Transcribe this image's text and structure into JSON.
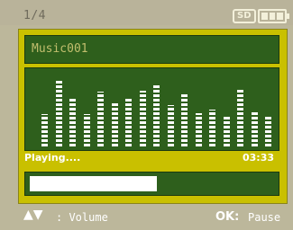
{
  "status_bar": {
    "page_indicator": "1/4",
    "storage_badge": "SD",
    "battery": {
      "icon": "battery-icon",
      "level": 1.0
    }
  },
  "player": {
    "track_title": "Music001",
    "status": "Playing....",
    "time": "03:33",
    "progress": 0.52,
    "visualizer_levels": [
      0.46,
      0.95,
      0.69,
      0.46,
      0.77,
      0.62,
      0.7,
      0.78,
      0.86,
      0.58,
      0.74,
      0.47,
      0.52,
      0.44,
      0.8,
      0.5,
      0.43
    ]
  },
  "footer": {
    "nav_arrows": "▲▼",
    "volume_hint": ": Volume",
    "ok_key": "OK:",
    "ok_action": "Pause"
  },
  "colors": {
    "frame": "#c9c000",
    "panel": "#2e5f1c",
    "background": "#bcb79b"
  }
}
